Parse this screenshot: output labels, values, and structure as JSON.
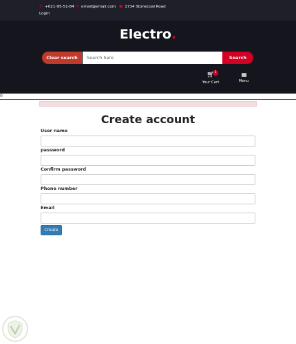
{
  "topbar": {
    "phone": "+021-95-51-84",
    "email": "email@email.com",
    "address": "1734 Stonecoal Road",
    "login_label": "Login"
  },
  "header": {
    "logo_text": "Electro",
    "logo_dot": ".",
    "clear_label": "Clear search",
    "search_placeholder": "Search here",
    "search_label": "Search",
    "cart_label": "Your Cart",
    "cart_count": "3",
    "menu_label": "Menu"
  },
  "stray_text": "0",
  "form": {
    "title": "Create account",
    "fields": [
      {
        "label": "User name",
        "value": ""
      },
      {
        "label": "password",
        "value": ""
      },
      {
        "label": "Confirm password",
        "value": ""
      },
      {
        "label": "Phone number",
        "value": ""
      },
      {
        "label": "Email",
        "value": ""
      }
    ],
    "submit_label": "Create"
  },
  "colors": {
    "brand_red": "#d10024",
    "header_bg": "#15161d",
    "topbar_bg": "#1e1f29",
    "button_blue": "#337ab7"
  },
  "icons": [
    "phone-icon",
    "envelope-icon",
    "map-marker-icon",
    "cart-icon",
    "menu-icon",
    "watermark-shield-icon"
  ]
}
